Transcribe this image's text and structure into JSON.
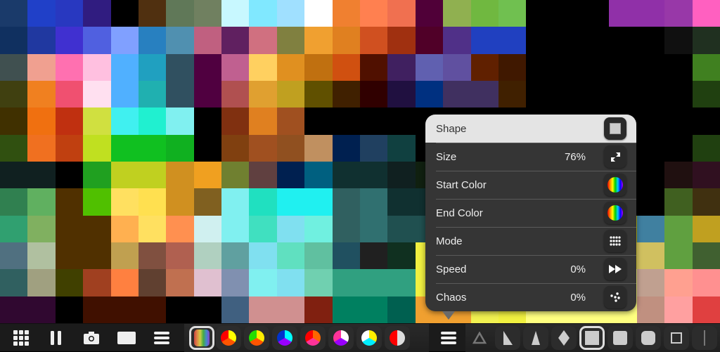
{
  "popup": {
    "rows": [
      {
        "label": "Shape",
        "value": "",
        "icon": "square-icon"
      },
      {
        "label": "Size",
        "value": "76%",
        "icon": "resize-icon"
      },
      {
        "label": "Start Color",
        "value": "",
        "icon": "color-wheel-icon"
      },
      {
        "label": "End Color",
        "value": "",
        "icon": "color-wheel-icon"
      },
      {
        "label": "Mode",
        "value": "",
        "icon": "grid-dots-icon"
      },
      {
        "label": "Speed",
        "value": "0%",
        "icon": "fast-forward-icon"
      },
      {
        "label": "Chaos",
        "value": "0%",
        "icon": "scatter-dots-icon"
      }
    ]
  },
  "toolbar": {
    "left_icons": [
      "grid-icon",
      "pause-icon",
      "camera-icon",
      "rectangle-icon",
      "menu-icon"
    ],
    "palettes": [
      [
        "#ffff00",
        "#ff5500",
        "#ff0000"
      ],
      [
        "#ffee00",
        "#ff5500",
        "#22dd00"
      ],
      [
        "#00ffff",
        "#9900ff",
        "#0033cc"
      ],
      [
        "#ff6600",
        "#ff3399",
        "#ff0000"
      ],
      [
        "#ffffff",
        "#9900ff",
        "#ff3399"
      ],
      [
        "#ffee00",
        "#00eeff",
        "#ffffff"
      ],
      [
        "#dddddd",
        "#dddddd",
        "#ff0000"
      ]
    ],
    "shapes": [
      "triangle-outline",
      "right-triangle",
      "tall-triangle",
      "diamond",
      "square",
      "rounded-square",
      "rounder-square",
      "square-outline",
      "line"
    ],
    "selected_shape": "square"
  }
}
